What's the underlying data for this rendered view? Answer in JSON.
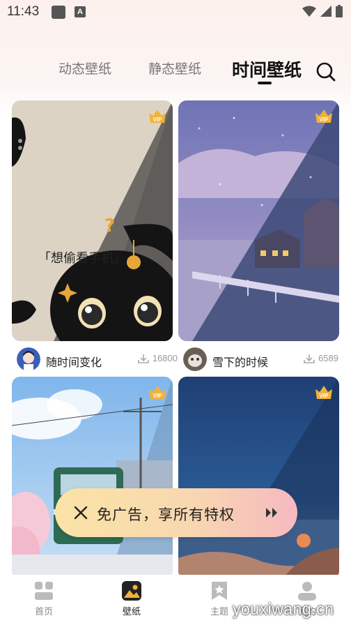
{
  "status_bar": {
    "time": "11:43",
    "notif_icon_letter": "A"
  },
  "tabs": [
    {
      "label": "动态壁纸",
      "active": false
    },
    {
      "label": "静态壁纸",
      "active": false
    },
    {
      "label": "时间壁纸",
      "active": true
    }
  ],
  "wallpapers": [
    {
      "badge": "VIP",
      "art_caption": "「想偷看手机」",
      "author": "随时间变化",
      "downloads": "16800"
    },
    {
      "badge": "VIP",
      "author": "雪下的时候",
      "downloads": "6589"
    },
    {
      "badge": "VIP"
    },
    {
      "badge": "VIP"
    }
  ],
  "promo": {
    "text": "免广告，享所有特权"
  },
  "bottom_nav": [
    {
      "label": "首页",
      "icon": "home-icon",
      "active": false
    },
    {
      "label": "壁纸",
      "icon": "wallpaper-icon",
      "active": true
    },
    {
      "label": "主题",
      "icon": "theme-icon",
      "active": false
    },
    {
      "label": "我的",
      "icon": "profile-icon",
      "active": false
    }
  ],
  "watermark": "youxiwang.cn",
  "colors": {
    "active_tab": "#111111",
    "inactive_tab": "#777777",
    "vip_gold": "#f2b23a",
    "promo_start": "#fbe3a6",
    "promo_end": "#f6b9c0"
  }
}
